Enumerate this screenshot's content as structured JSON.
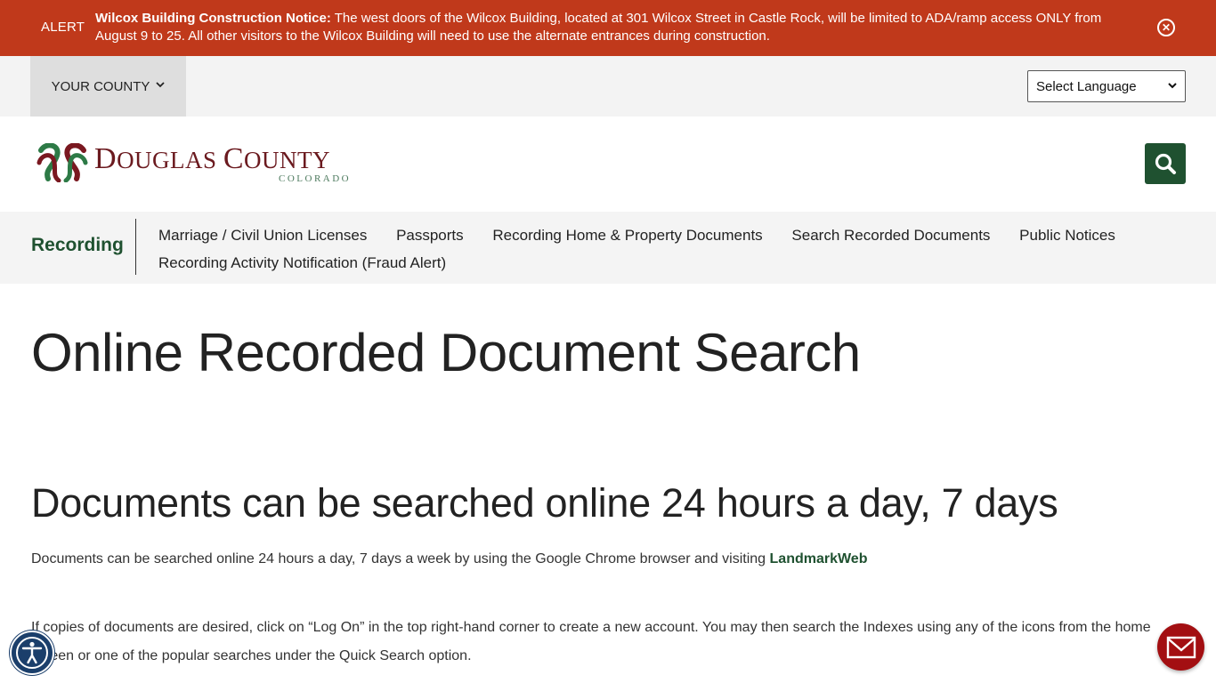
{
  "alert": {
    "label": "ALERT",
    "title": "Wilcox Building Construction Notice:",
    "message": " The west doors of the Wilcox Building, located at 301 Wilcox Street in Castle Rock, will be limited to ADA/ramp access ONLY from August 9 to 25.   All other visitors to the Wilcox Building will need to use the alternate entrances during construction.",
    "close_icon": "circle-x-icon",
    "close_glyph": "✕"
  },
  "utility": {
    "county_menu_label": "YOUR COUNTY",
    "county_chevron": "⌄",
    "language_select": {
      "selected": "Select Language",
      "chevron": "⌄"
    }
  },
  "header": {
    "logo": {
      "name_big1": "D",
      "name_small1": "OUGLAS ",
      "name_big2": "C",
      "name_small2": "OUNTY",
      "subtitle": "COLORADO"
    },
    "search_icon": "search-icon"
  },
  "subnav": {
    "section": "Recording",
    "links": [
      "Marriage / Civil Union Licenses",
      "Passports",
      "Recording Home & Property Documents",
      "Search Recorded Documents",
      "Public Notices",
      "Recording Activity Notification (Fraud Alert)"
    ]
  },
  "main": {
    "page_title": "Online Recorded Document Search",
    "section_title": "Documents can be searched online 24 hours a day, 7 days",
    "para1_text": "Documents can be searched online 24 hours a day, 7 days a week by using the Google Chrome browser and visiting ",
    "para1_link": "LandmarkWeb",
    "para2": "If copies of documents are desired, click on “Log On” in the top right-hand corner to create a new account. You may then search the Indexes using any of the icons from the home screen or one of the popular searches under the Quick Search option."
  },
  "floating": {
    "accessibility_icon": "accessibility-icon",
    "contact_icon": "envelope-icon"
  },
  "colors": {
    "alert_bg": "#c0391b",
    "brand_green": "#1f5130",
    "brand_maroon": "#6b1a1f",
    "contact_red": "#a30f12",
    "a11y_blue": "#1b3f6b"
  }
}
